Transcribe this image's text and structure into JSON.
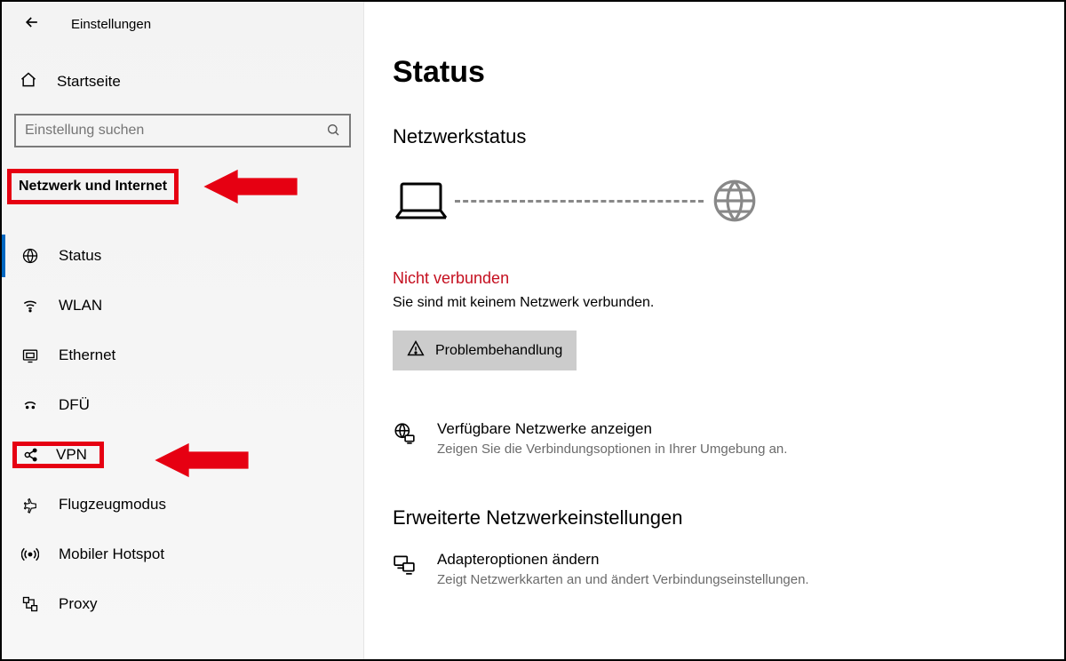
{
  "header": {
    "app_title": "Einstellungen"
  },
  "sidebar": {
    "home_label": "Startseite",
    "search_placeholder": "Einstellung suchen",
    "category_label": "Netzwerk und Internet",
    "items": [
      {
        "label": "Status"
      },
      {
        "label": "WLAN"
      },
      {
        "label": "Ethernet"
      },
      {
        "label": "DFÜ"
      },
      {
        "label": "VPN"
      },
      {
        "label": "Flugzeugmodus"
      },
      {
        "label": "Mobiler Hotspot"
      },
      {
        "label": "Proxy"
      }
    ]
  },
  "main": {
    "page_title": "Status",
    "network_status_heading": "Netzwerkstatus",
    "not_connected_label": "Nicht verbunden",
    "not_connected_desc": "Sie sind mit keinem Netzwerk verbunden.",
    "troubleshoot_label": "Problembehandlung",
    "available_networks": {
      "title": "Verfügbare Netzwerke anzeigen",
      "desc": "Zeigen Sie die Verbindungsoptionen in Ihrer Umgebung an."
    },
    "advanced_heading": "Erweiterte Netzwerkeinstellungen",
    "adapter_options": {
      "title": "Adapteroptionen ändern",
      "desc": "Zeigt Netzwerkkarten an und ändert Verbindungseinstellungen."
    }
  }
}
